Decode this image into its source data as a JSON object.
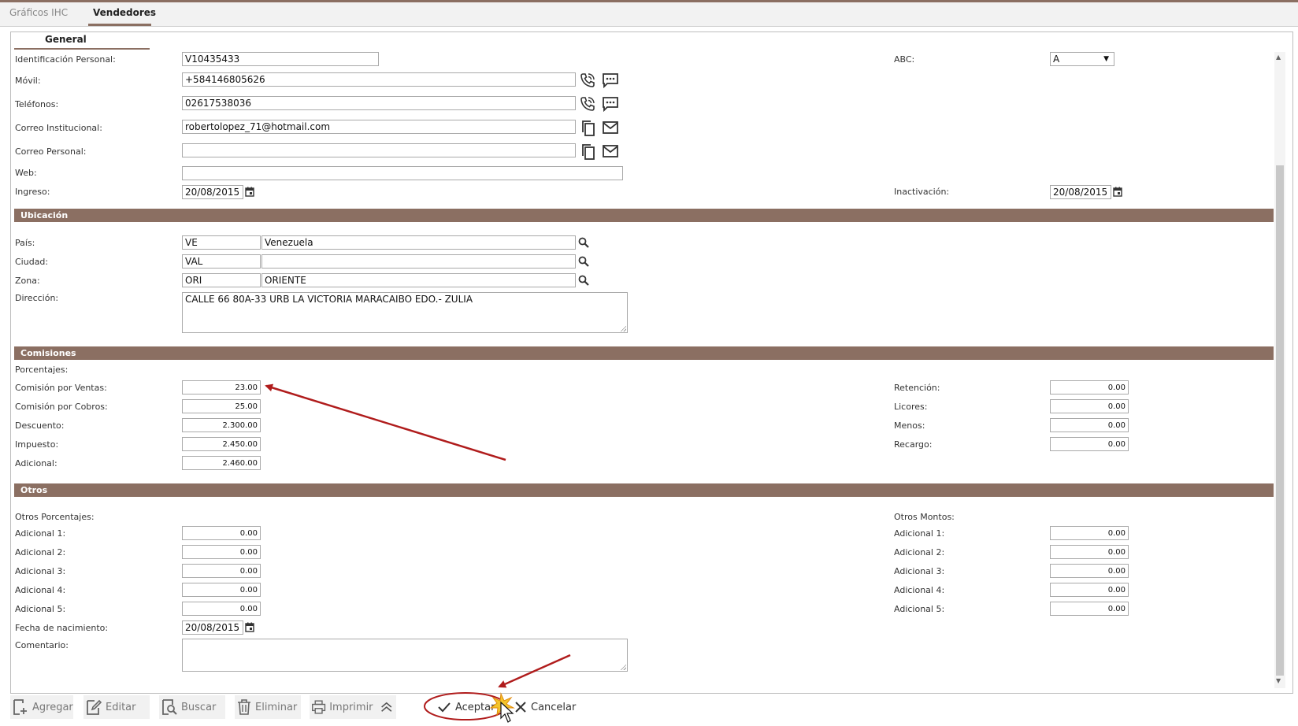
{
  "tabs": [
    {
      "label": "Gráficos IHC",
      "active": false
    },
    {
      "label": "Vendedores",
      "active": true
    }
  ],
  "subtab": "General",
  "personal": {
    "id_label": "Identificación Personal:",
    "id_value": "V10435433",
    "movil_label": "Móvil:",
    "movil_value": "+584146805626",
    "telefonos_label": "Teléfonos:",
    "telefonos_value": "02617538036",
    "correo_inst_label": "Correo Institucional:",
    "correo_inst_value": "robertolopez_71@hotmail.com",
    "correo_pers_label": "Correo Personal:",
    "correo_pers_value": "",
    "web_label": "Web:",
    "web_value": "",
    "ingreso_label": "Ingreso:",
    "ingreso_value": "20/08/2015",
    "abc_label": "ABC:",
    "abc_value": "A",
    "inactivacion_label": "Inactivación:",
    "inactivacion_value": "20/08/2015"
  },
  "ubicacion": {
    "title": "Ubicación",
    "pais_label": "País:",
    "pais_code": "VE",
    "pais_name": "Venezuela",
    "ciudad_label": "Ciudad:",
    "ciudad_code": "VAL",
    "ciudad_name": "",
    "zona_label": "Zona:",
    "zona_code": "ORI",
    "zona_name": "ORIENTE",
    "direccion_label": "Dirección:",
    "direccion_value": "CALLE 66 80A-33 URB LA VICTORIA MARACAIBO EDO.- ZULIA"
  },
  "comisiones": {
    "title": "Comisiones",
    "porcentajes_label": "Porcentajes:",
    "left": [
      {
        "label": "Comisión por Ventas:",
        "value": "23.00"
      },
      {
        "label": "Comisión por Cobros:",
        "value": "25.00"
      },
      {
        "label": "Descuento:",
        "value": "2.300.00"
      },
      {
        "label": "Impuesto:",
        "value": "2.450.00"
      },
      {
        "label": "Adicional:",
        "value": "2.460.00"
      }
    ],
    "right": [
      {
        "label": "Retención:",
        "value": "0.00"
      },
      {
        "label": "Licores:",
        "value": "0.00"
      },
      {
        "label": "Menos:",
        "value": "0.00"
      },
      {
        "label": "Recargo:",
        "value": "0.00"
      }
    ]
  },
  "otros": {
    "title": "Otros",
    "porcentajes_label": "Otros Porcentajes:",
    "montos_label": "Otros Montos:",
    "left": [
      {
        "label": "Adicional 1:",
        "value": "0.00"
      },
      {
        "label": "Adicional 2:",
        "value": "0.00"
      },
      {
        "label": "Adicional 3:",
        "value": "0.00"
      },
      {
        "label": "Adicional 4:",
        "value": "0.00"
      },
      {
        "label": "Adicional 5:",
        "value": "0.00"
      }
    ],
    "right": [
      {
        "label": "Adicional 1:",
        "value": "0.00"
      },
      {
        "label": "Adicional 2:",
        "value": "0.00"
      },
      {
        "label": "Adicional 3:",
        "value": "0.00"
      },
      {
        "label": "Adicional 4:",
        "value": "0.00"
      },
      {
        "label": "Adicional 5:",
        "value": "0.00"
      }
    ],
    "nacimiento_label": "Fecha de nacimiento:",
    "nacimiento_value": "20/08/2015",
    "comentario_label": "Comentario:",
    "comentario_value": ""
  },
  "toolbar": {
    "agregar": "Agregar",
    "editar": "Editar",
    "buscar": "Buscar",
    "eliminar": "Eliminar",
    "imprimir": "Imprimir",
    "aceptar": "Aceptar",
    "cancelar": "Cancelar"
  },
  "colors": {
    "section": "#8b6f62",
    "annotation": "#b01c1c"
  },
  "icons": [
    "phone-call-icon",
    "sms-icon",
    "copy-icon",
    "email-icon",
    "calendar-icon",
    "search-icon",
    "scroll-up-icon",
    "check-icon",
    "close-icon",
    "cursor-icon"
  ]
}
